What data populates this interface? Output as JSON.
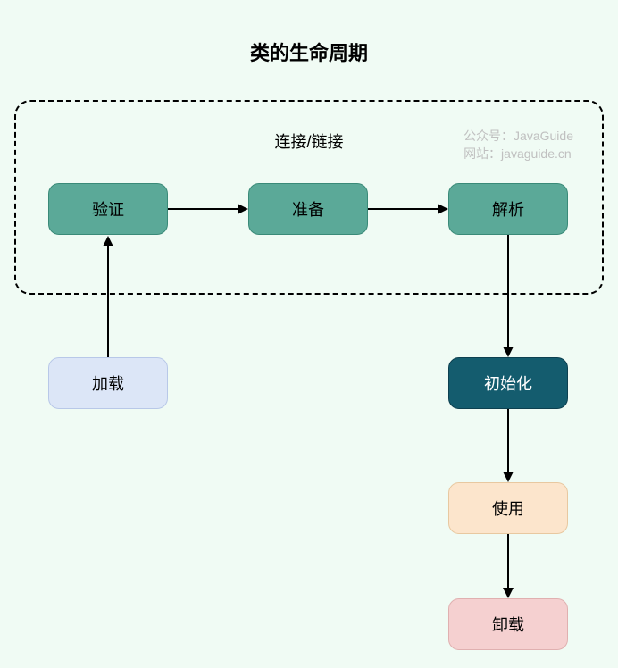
{
  "title": "类的生命周期",
  "subtitle": "连接/链接",
  "watermark": {
    "line1": "公众号：JavaGuide",
    "line2": "网站：javaguide.cn"
  },
  "nodes": {
    "load": "加载",
    "verify": "验证",
    "prepare": "准备",
    "resolve": "解析",
    "initialize": "初始化",
    "use": "使用",
    "unload": "卸载"
  }
}
